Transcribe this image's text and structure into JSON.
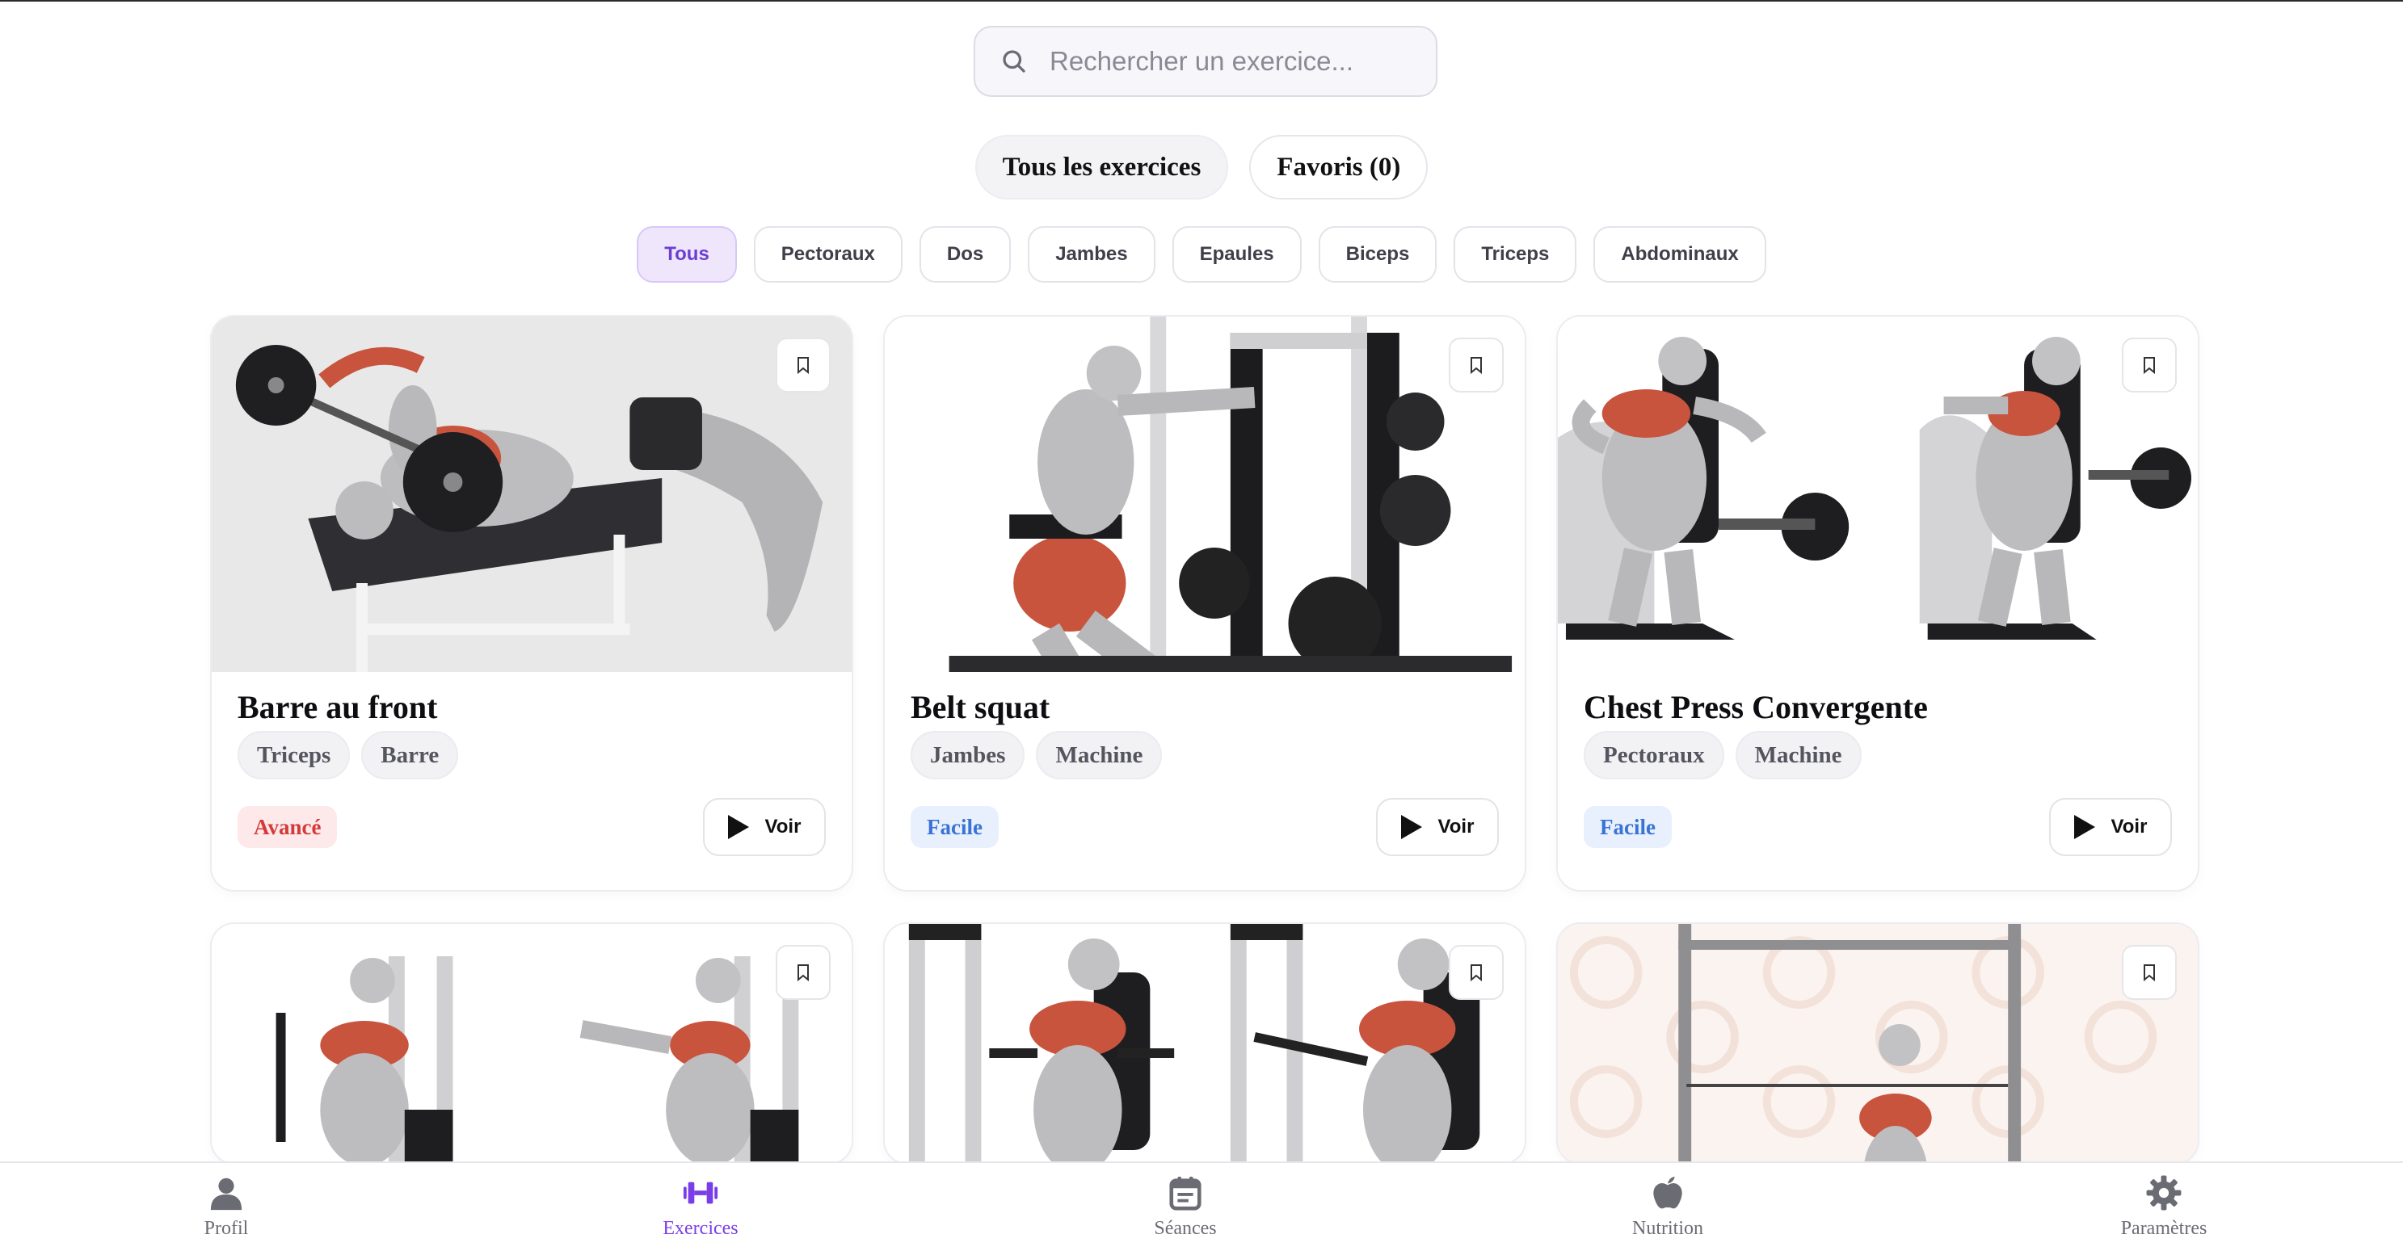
{
  "search": {
    "placeholder": "Rechercher un exercice..."
  },
  "main_tabs": [
    {
      "label": "Tous les exercices",
      "active": true
    },
    {
      "label": "Favoris (0)",
      "active": false
    }
  ],
  "categories": [
    {
      "label": "Tous",
      "active": true
    },
    {
      "label": "Pectoraux"
    },
    {
      "label": "Dos"
    },
    {
      "label": "Jambes"
    },
    {
      "label": "Epaules"
    },
    {
      "label": "Biceps"
    },
    {
      "label": "Triceps"
    },
    {
      "label": "Abdominaux"
    }
  ],
  "exercises": [
    {
      "title": "Barre au front",
      "tags": [
        "Triceps",
        "Barre"
      ],
      "level": "Avancé",
      "action": "Voir"
    },
    {
      "title": "Belt squat",
      "tags": [
        "Jambes",
        "Machine"
      ],
      "level": "Facile",
      "action": "Voir"
    },
    {
      "title": "Chest Press Convergente",
      "tags": [
        "Pectoraux",
        "Machine"
      ],
      "level": "Facile",
      "action": "Voir"
    }
  ],
  "colors": {
    "accent": "#7a3ee8",
    "level_hard": "#d43a3a",
    "level_easy": "#3a73d6",
    "muscle": "#c8543e"
  },
  "bottom_nav": [
    {
      "label": "Profil",
      "icon": "user-icon"
    },
    {
      "label": "Exercices",
      "icon": "dumbbell-icon",
      "active": true
    },
    {
      "label": "Séances",
      "icon": "calendar-icon"
    },
    {
      "label": "Nutrition",
      "icon": "apple-icon"
    },
    {
      "label": "Paramètres",
      "icon": "gear-icon"
    }
  ]
}
